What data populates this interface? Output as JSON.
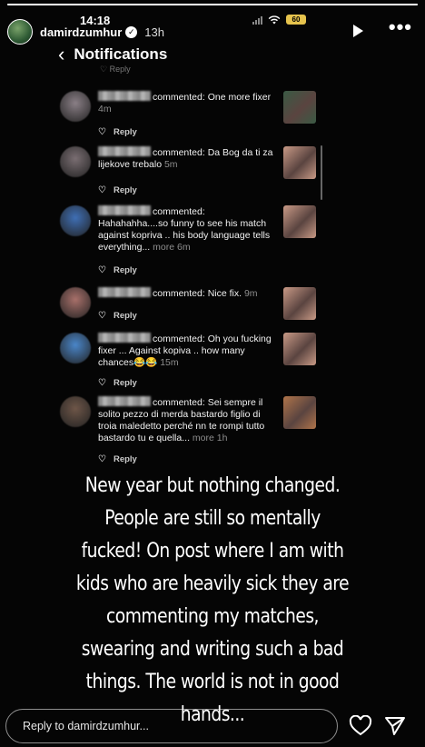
{
  "status_bar": {
    "time": "14:18",
    "battery": "60"
  },
  "story": {
    "username": "damirdzumhur",
    "posted_ago": "13h"
  },
  "notifications_screen": {
    "title": "Notifications",
    "top_partial_label": "Reply",
    "reply_label": "Reply",
    "items": [
      {
        "text": "commented: One more fixer",
        "ago": "4m",
        "more": "",
        "pfp_color": "#8a7f86",
        "thumb_color": "#3a5a44"
      },
      {
        "text": "commented: Da Bog da ti za lijekove trebalo",
        "ago": "5m",
        "more": "",
        "pfp_color": "#7a6e72",
        "thumb_color": "#c99a86"
      },
      {
        "text": "commented: Hahahahha....so funny to see his match against kopriva .. his body language tells everything...",
        "ago": "6m",
        "more": "more",
        "pfp_color": "#3f6fb5",
        "thumb_color": "#c99a86"
      },
      {
        "text": "commented: Nice fix.",
        "ago": "9m",
        "more": "",
        "pfp_color": "#a8706a",
        "thumb_color": "#c99a86"
      },
      {
        "text": "commented: Oh you fucking fixer ... Against kopiva .. how many chances😂😂",
        "ago": "15m",
        "more": "",
        "pfp_color": "#4a86c9",
        "thumb_color": "#c99a86"
      },
      {
        "text": "commented: Sei sempre il solito pezzo di merda bastardo figlio di troia maledetto perché nn te rompi tutto bastardo tu e quella...",
        "ago": "1h",
        "more": "more",
        "pfp_color": "#6e5648",
        "thumb_color": "#b0744a"
      }
    ]
  },
  "caption": {
    "lines": [
      "New year but nothing changed.",
      "People are still so mentally",
      "fucked! On post where I am with",
      "kids who are heavily sick they are",
      "commenting my matches,",
      "swearing and writing such a bad",
      "things. The world is not in good",
      "hands..."
    ]
  },
  "reply_bar": {
    "placeholder": "Reply to damirdzumhur..."
  },
  "icons": {
    "play": "play-icon",
    "more": "more-icon",
    "heart": "heart-icon",
    "send": "send-icon",
    "back": "chevron-left-icon",
    "verified": "verified-badge-icon"
  }
}
